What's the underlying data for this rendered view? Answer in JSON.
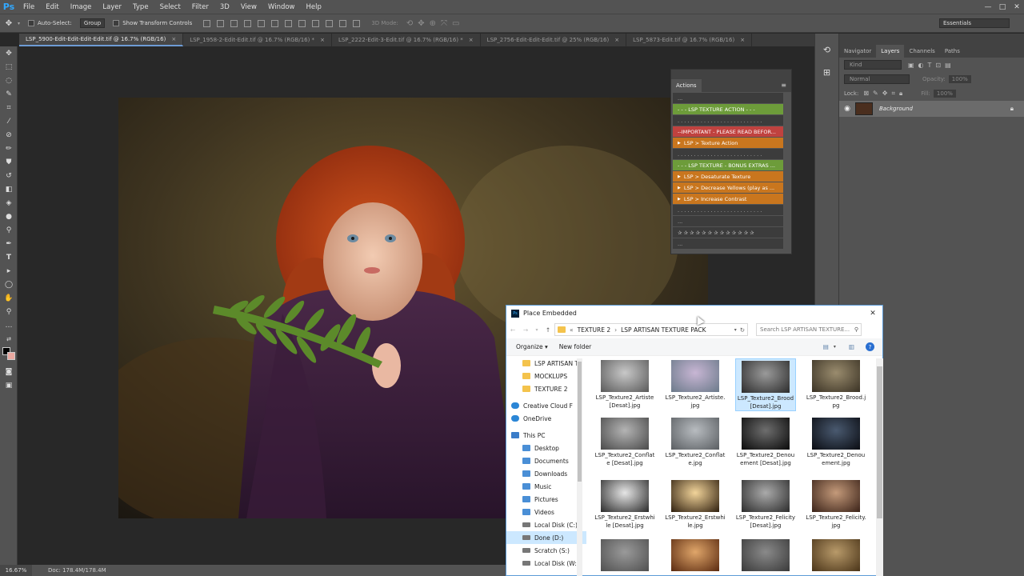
{
  "menubar": {
    "logo": "Ps",
    "items": [
      "File",
      "Edit",
      "Image",
      "Layer",
      "Type",
      "Select",
      "Filter",
      "3D",
      "View",
      "Window",
      "Help"
    ],
    "window_controls": [
      "—",
      "□",
      "✕"
    ]
  },
  "options": {
    "auto_select": "Auto-Select:",
    "group": "Group",
    "transform": "Show Transform Controls",
    "mode_3d": "3D Mode:",
    "workspace": "Essentials"
  },
  "tabs": [
    {
      "label": "LSP_5900-Edit-Edit-Edit-Edit.tif @ 16.7% (RGB/16)",
      "close": "×",
      "active": true
    },
    {
      "label": "LSP_1958-2-Edit-Edit.tif @ 16.7% (RGB/16) *",
      "close": "×",
      "active": false
    },
    {
      "label": "LSP_2222-Edit-3-Edit.tif @ 16.7% (RGB/16) *",
      "close": "×",
      "active": false
    },
    {
      "label": "LSP_2756-Edit-Edit-Edit.tif @ 25% (RGB/16)",
      "close": "×",
      "active": false
    },
    {
      "label": "LSP_5873-Edit.tif @ 16.7% (RGB/16)",
      "close": "×",
      "active": false
    }
  ],
  "status": {
    "zoom": "16.67%",
    "doc": "Doc: 178.4M/178.4M"
  },
  "layers_panel": {
    "tabs": [
      "Navigator",
      "Layers",
      "Channels",
      "Paths"
    ],
    "active_tab": "Layers",
    "kind": "Kind",
    "blend": "Normal",
    "opacity_label": "Opacity:",
    "opacity": "100%",
    "lock_label": "Lock:",
    "fill_label": "Fill:",
    "fill": "100%",
    "layer_name": "Background"
  },
  "actions_panel": {
    "title": "Actions",
    "rows": [
      {
        "text": "...",
        "style": "dark",
        "expand": false
      },
      {
        "text": "- - - LSP TEXTURE ACTION - - -",
        "style": "green",
        "expand": false
      },
      {
        "text": ". . . . . . . . . . . . . . . . . . . . . . . . . .",
        "style": "dark",
        "expand": false
      },
      {
        "text": "--IMPORTANT - PLEASE READ BEFOR...",
        "style": "red",
        "expand": false
      },
      {
        "text": "LSP > Texture Action",
        "style": "orange",
        "expand": true
      },
      {
        "text": ". . . . . . . . . . . . . . . . . . . . . . . . . .",
        "style": "dark",
        "expand": false
      },
      {
        "text": "- - - LSP TEXTURE - BONUS EXTRAS ...",
        "style": "green",
        "expand": false
      },
      {
        "text": "LSP > Desaturate Texture",
        "style": "orange",
        "expand": true
      },
      {
        "text": "LSP > Decrease Yellows (play as ...",
        "style": "orange",
        "expand": true
      },
      {
        "text": "LSP > Increase Contrast",
        "style": "orange",
        "expand": true
      },
      {
        "text": ". . . . . . . . . . . . . . . . . . . . . . . . . .",
        "style": "dark",
        "expand": false
      },
      {
        "text": "...",
        "style": "dark",
        "expand": false
      },
      {
        "text": "✰ ✰ ✰ ✰ ✰ ✰ ✰ ✰ ✰ ✰ ✰ ✰ ✰",
        "style": "dark",
        "expand": false
      },
      {
        "text": "...",
        "style": "dark",
        "expand": false
      }
    ]
  },
  "dialog": {
    "title": "Place Embedded",
    "close": "✕",
    "path_prefix": "«",
    "path": [
      "TEXTURE 2",
      "LSP ARTISAN TEXTURE PACK"
    ],
    "path_sep": "›",
    "search_placeholder": "Search LSP ARTISAN TEXTURE...",
    "organize": "Organize ▾",
    "new_folder": "New folder",
    "help": "?",
    "nav": [
      {
        "label": "LSP ARTISAN T",
        "type": "folder",
        "selected": false
      },
      {
        "label": "MOCKLUPS",
        "type": "folder",
        "selected": false
      },
      {
        "label": "TEXTURE 2",
        "type": "folder",
        "selected": false
      },
      {
        "label": "Creative Cloud F",
        "type": "cloud",
        "selected": false
      },
      {
        "label": "OneDrive",
        "type": "cloud",
        "selected": false
      },
      {
        "label": "This PC",
        "type": "pc",
        "selected": false
      },
      {
        "label": "Desktop",
        "type": "folder-blue",
        "selected": false
      },
      {
        "label": "Documents",
        "type": "folder-blue",
        "selected": false
      },
      {
        "label": "Downloads",
        "type": "folder-blue",
        "selected": false
      },
      {
        "label": "Music",
        "type": "folder-blue",
        "selected": false
      },
      {
        "label": "Pictures",
        "type": "folder-blue",
        "selected": false
      },
      {
        "label": "Videos",
        "type": "folder-blue",
        "selected": false
      },
      {
        "label": "Local Disk (C:)",
        "type": "drive",
        "selected": false
      },
      {
        "label": "Done (D:)",
        "type": "drive",
        "selected": true
      },
      {
        "label": "Scratch (S:)",
        "type": "drive",
        "selected": false
      },
      {
        "label": "Local Disk (W:)",
        "type": "drive",
        "selected": false
      }
    ],
    "files": [
      {
        "name": "LSP_Texture2_Artiste [Desat].jpg",
        "colors": [
          "#c8c8c8",
          "#5a5a5a"
        ],
        "selected": false
      },
      {
        "name": "LSP_Texture2_Artiste.jpg",
        "colors": [
          "#c8b6d4",
          "#6b7a8a"
        ],
        "selected": false
      },
      {
        "name": "LSP_Texture2_Brood [Desat].jpg",
        "colors": [
          "#9a9a9a",
          "#2c2c2c"
        ],
        "selected": true
      },
      {
        "name": "LSP_Texture2_Brood.jpg",
        "colors": [
          "#9a8c6e",
          "#3a3224"
        ],
        "selected": false
      },
      {
        "name": "LSP_Texture2_Conflate [Desat].jpg",
        "colors": [
          "#b4b4b4",
          "#4a4a4a"
        ],
        "selected": false
      },
      {
        "name": "LSP_Texture2_Conflate.jpg",
        "colors": [
          "#b8bcc0",
          "#5a5e62"
        ],
        "selected": false
      },
      {
        "name": "LSP_Texture2_Denouement [Desat].jpg",
        "colors": [
          "#6e6e6e",
          "#0a0a0a"
        ],
        "selected": false
      },
      {
        "name": "LSP_Texture2_Denouement.jpg",
        "colors": [
          "#4a5a70",
          "#0a0c12"
        ],
        "selected": false
      },
      {
        "name": "LSP_Texture2_Erstwhile [Desat].jpg",
        "colors": [
          "#e6e6e6",
          "#2a2a2a"
        ],
        "selected": false
      },
      {
        "name": "LSP_Texture2_Erstwhile.jpg",
        "colors": [
          "#f2d49a",
          "#2e1e0e"
        ],
        "selected": false
      },
      {
        "name": "LSP_Texture2_Felicity [Desat].jpg",
        "colors": [
          "#aaaaaa",
          "#2c2c2c"
        ],
        "selected": false
      },
      {
        "name": "LSP_Texture2_Felicity.jpg",
        "colors": [
          "#c49a7a",
          "#3a2218"
        ],
        "selected": false
      },
      {
        "name": "",
        "colors": [
          "#9a9a9a",
          "#505050"
        ],
        "selected": false
      },
      {
        "name": "",
        "colors": [
          "#e0a66a",
          "#5a2a10"
        ],
        "selected": false
      },
      {
        "name": "",
        "colors": [
          "#8a8a8a",
          "#3a3a3a"
        ],
        "selected": false
      },
      {
        "name": "",
        "colors": [
          "#b89a6a",
          "#4a3418"
        ],
        "selected": false
      }
    ]
  }
}
